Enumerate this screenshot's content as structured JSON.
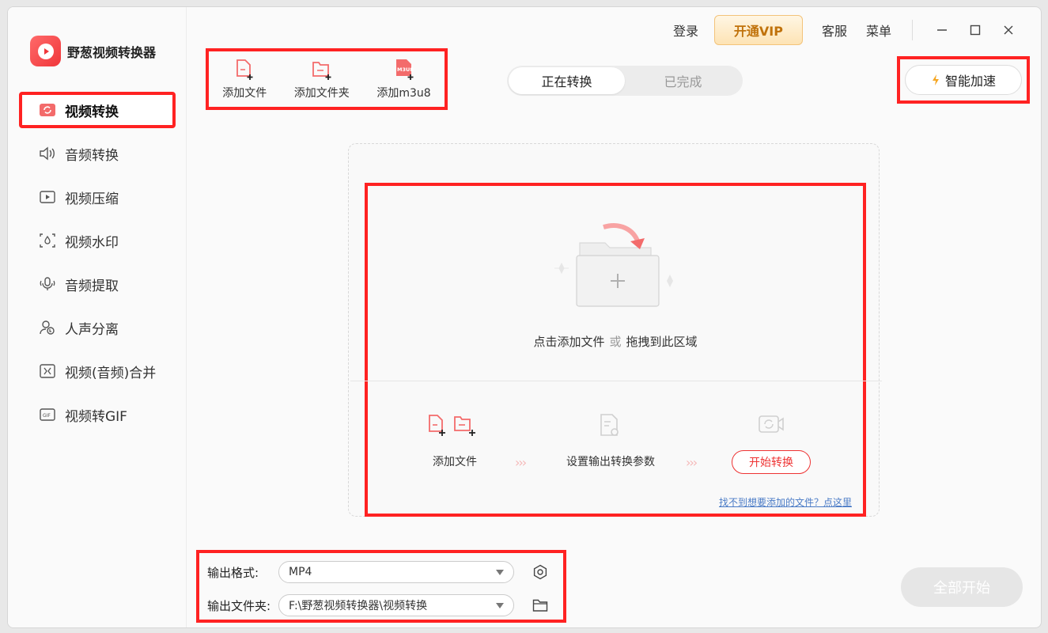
{
  "app": {
    "name": "野葱视频转换器",
    "logo_icon": "play-logo-icon"
  },
  "sidebar": {
    "items": [
      {
        "label": "视频转换",
        "icon": "video-convert-icon",
        "active": true
      },
      {
        "label": "音频转换",
        "icon": "speaker-icon"
      },
      {
        "label": "视频压缩",
        "icon": "compress-icon"
      },
      {
        "label": "视频水印",
        "icon": "watermark-icon"
      },
      {
        "label": "音频提取",
        "icon": "mic-icon"
      },
      {
        "label": "人声分离",
        "icon": "vocal-split-icon"
      },
      {
        "label": "视频(音频)合并",
        "icon": "merge-icon"
      },
      {
        "label": "视频转GIF",
        "icon": "gif-icon"
      }
    ]
  },
  "header": {
    "login": "登录",
    "vip": "开通VIP",
    "service": "客服",
    "menu": "菜单"
  },
  "toolbar": {
    "add_file": "添加文件",
    "add_folder": "添加文件夹",
    "add_m3u8": "添加m3u8",
    "m3u8_badge": "M3U8"
  },
  "tabs": [
    {
      "label": "正在转换",
      "active": true
    },
    {
      "label": "已完成",
      "active": false
    }
  ],
  "accelerate": {
    "label": "智能加速"
  },
  "dropzone": {
    "text_click": "点击添加文件",
    "text_or": "或",
    "text_drag": "拖拽到此区域",
    "steps": {
      "add_file": "添加文件",
      "set_params": "设置输出转换参数",
      "start": "开始转换"
    },
    "help": "找不到想要添加的文件？点这里"
  },
  "output": {
    "format_label": "输出格式:",
    "format_value": "MP4",
    "folder_label": "输出文件夹:",
    "folder_value": "F:\\野葱视频转换器\\视频转换"
  },
  "start_all": "全部开始",
  "colors": {
    "accent": "#f0363a",
    "highlight": "#ff2222",
    "vip_text": "#c0720b"
  }
}
